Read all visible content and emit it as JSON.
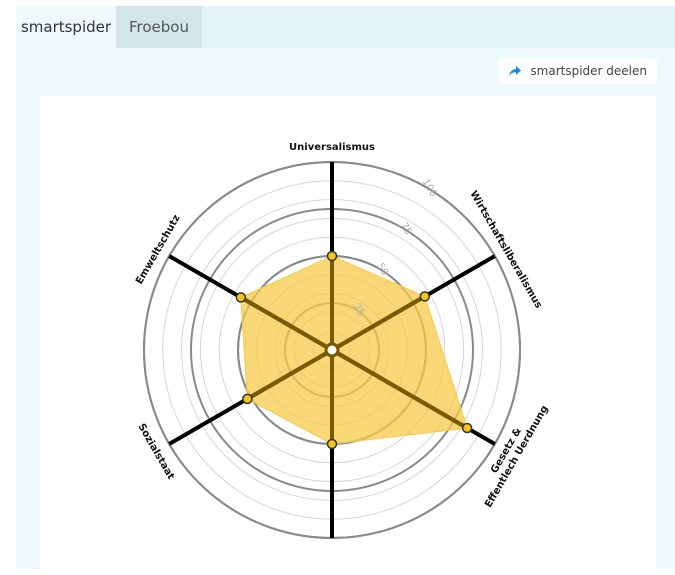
{
  "tabs": [
    {
      "label": "smartspider",
      "active": true
    },
    {
      "label": "Froebou",
      "active": false
    }
  ],
  "share_button": {
    "label": "smartspider deelen",
    "icon": "share-arrow-icon"
  },
  "colors": {
    "fill": "#f7c948",
    "axis": "#000000",
    "marker": "#f5c518"
  },
  "chart_data": {
    "type": "radar",
    "title": "",
    "axes": [
      "Universalismus",
      "Wirtschaftsliberalismus",
      "Gesetz & Effentlech Uerdnung",
      "Sozialstaat",
      "Emweltschutz"
    ],
    "axis_labels": [
      {
        "lines": [
          "Universalismus"
        ]
      },
      {
        "lines": [
          "Wirtschaftsliberalismus"
        ]
      },
      {
        "lines": [
          "Gesetz &",
          "Effentlech Uerdnung"
        ]
      },
      {
        "lines": [
          "Sozialstaat"
        ]
      },
      {
        "lines": [
          "Emweltschutz"
        ]
      }
    ],
    "values": [
      50,
      57,
      83,
      50,
      52,
      56
    ],
    "rlim": [
      0,
      100
    ],
    "ticks": [
      25,
      50,
      75,
      100
    ],
    "tick_labels": [
      "25",
      "50",
      "75",
      "100"
    ],
    "grid": true
  }
}
